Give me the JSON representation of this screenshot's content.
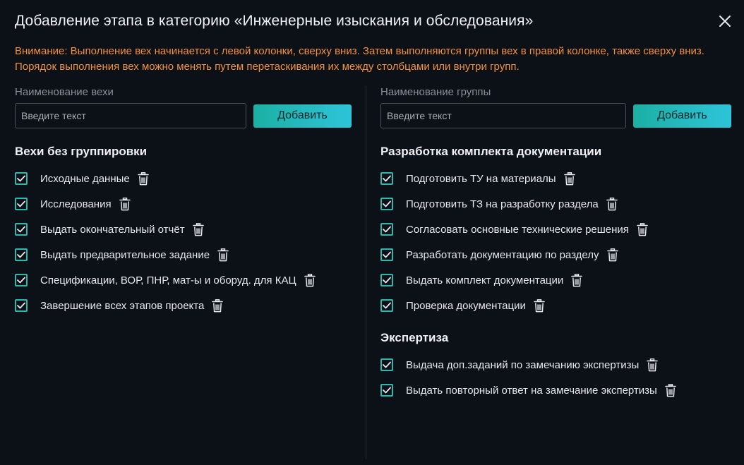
{
  "dialog": {
    "title": "Добавление этапа в категорию «Инженерные изыскания и обследования»",
    "warning": "Внимание: Выполнение вех начинается с левой колонки, сверху вниз. Затем выполняются группы вех в правой колонке, также сверху вниз. Порядок выполнения вех можно менять путем перетаскивания их между столбцами или внутри групп.",
    "accent_color": "#2fb7ad",
    "warning_color": "#f2913b"
  },
  "left": {
    "field_label": "Наименование вехи",
    "input_placeholder": "Введите текст",
    "input_value": "",
    "add_label": "Добавить",
    "group_title": "Вехи без группировки",
    "items": [
      {
        "label": "Исходные данные",
        "checked": true
      },
      {
        "label": "Исследования",
        "checked": true
      },
      {
        "label": "Выдать окончательный отчёт",
        "checked": true
      },
      {
        "label": "Выдать предварительное задание",
        "checked": true
      },
      {
        "label": "Спецификации, ВОР, ПНР, мат-ы и оборуд. для КАЦ",
        "checked": true
      },
      {
        "label": "Завершение всех этапов проекта",
        "checked": true
      }
    ]
  },
  "right": {
    "field_label": "Наименование группы",
    "input_placeholder": "Введите текст",
    "input_value": "",
    "add_label": "Добавить",
    "groups": [
      {
        "title": "Разработка комплекта документации",
        "items": [
          {
            "label": "Подготовить ТУ на материалы",
            "checked": true
          },
          {
            "label": "Подготовить ТЗ на разработку раздела",
            "checked": true
          },
          {
            "label": "Согласовать основные технические решения",
            "checked": true
          },
          {
            "label": "Разработать документацию по разделу",
            "checked": true
          },
          {
            "label": "Выдать комплект документации",
            "checked": true
          },
          {
            "label": "Проверка документации",
            "checked": true
          }
        ]
      },
      {
        "title": "Экспертиза",
        "items": [
          {
            "label": "Выдача доп.заданий по замечанию экспертизы",
            "checked": true
          },
          {
            "label": "Выдать повторный ответ на замечание экспертизы",
            "checked": true
          }
        ]
      }
    ]
  }
}
